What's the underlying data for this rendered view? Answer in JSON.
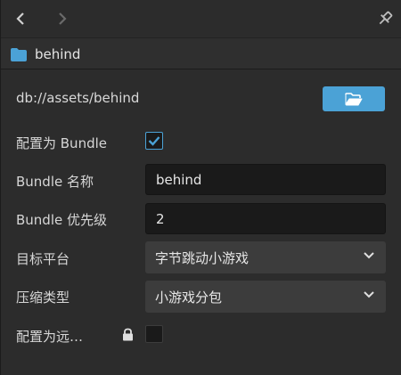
{
  "toolbar": {
    "back_icon": "chevron-left-icon",
    "forward_icon": "chevron-right-icon",
    "pin_icon": "pin-icon"
  },
  "asset": {
    "icon": "folder-icon",
    "name": "behind",
    "path": "db://assets/behind",
    "open_icon": "folder-open-icon"
  },
  "properties": {
    "is_bundle": {
      "label": "配置为 Bundle",
      "checked": true
    },
    "bundle_name": {
      "label": "Bundle 名称",
      "value": "behind"
    },
    "bundle_priority": {
      "label": "Bundle 优先级",
      "value": "2"
    },
    "target_platform": {
      "label": "目标平台",
      "value": "字节跳动小游戏"
    },
    "compression_type": {
      "label": "压缩类型",
      "value": "小游戏分包"
    },
    "is_remote": {
      "label": "配置为远…",
      "checked": false,
      "locked": true
    }
  },
  "colors": {
    "accent": "#4ba2d6",
    "background": "#2c2c2c",
    "input_bg": "#1a1a1a",
    "select_bg": "#3c3c3c"
  }
}
